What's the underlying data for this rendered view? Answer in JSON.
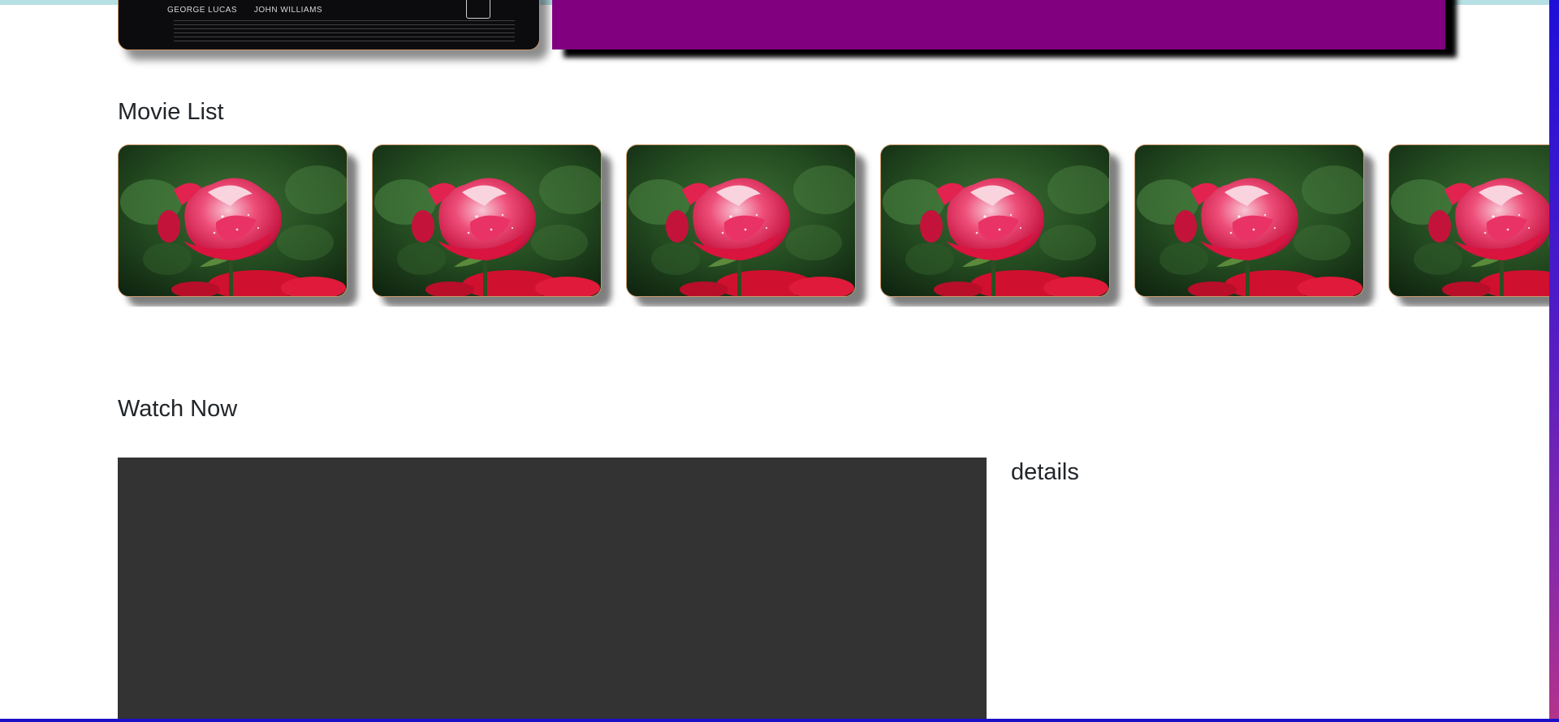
{
  "hero": {
    "poster_credits": [
      "GEORGE LUCAS",
      "JOHN WILLIAMS"
    ],
    "promo_color": "#800080"
  },
  "movie_list": {
    "title": "Movie List",
    "items": [
      {
        "image": "rose-photo"
      },
      {
        "image": "rose-photo"
      },
      {
        "image": "rose-photo"
      },
      {
        "image": "rose-photo"
      },
      {
        "image": "rose-photo"
      },
      {
        "image": "rose-photo"
      }
    ]
  },
  "watch_now": {
    "title": "Watch Now",
    "details_heading": "details"
  },
  "colors": {
    "card_border": "#c9976a",
    "player_bg": "#333333",
    "accent_gradient_top": "#1e0fd8",
    "accent_gradient_bottom": "#b4338b"
  }
}
